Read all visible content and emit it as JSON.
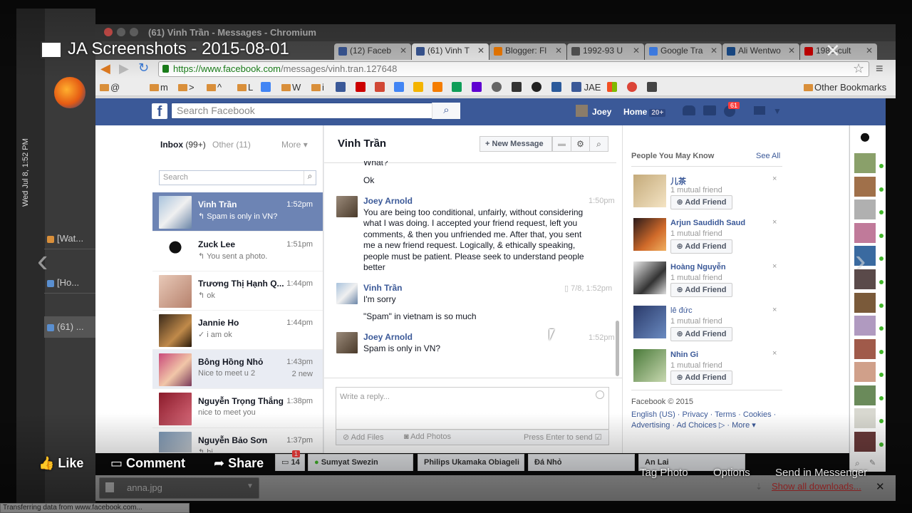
{
  "slideshow": {
    "title": "JA Screenshots - 2015-08-01",
    "like": "Like",
    "comment": "Comment",
    "share": "Share",
    "tag_photo": "Tag Photo",
    "options": "Options",
    "send_messenger": "Send in Messenger"
  },
  "desktop": {
    "clock": "Wed Jul 8, 1:52 PM",
    "tasks": [
      {
        "label": "[Wat..."
      },
      {
        "label": "[Ho..."
      },
      {
        "label": "(61) ..."
      }
    ]
  },
  "browser": {
    "window_title": "(61) Vinh Trần - Messages - Chromium",
    "tabs": [
      {
        "label": "(12) Faceb",
        "color": "#3b5998"
      },
      {
        "label": "(61) Vinh T",
        "color": "#3b5998"
      },
      {
        "label": "Blogger: Fl",
        "color": "#f57d00"
      },
      {
        "label": "1992-93 U",
        "color": "#555555"
      },
      {
        "label": "Google Tra",
        "color": "#4285f4"
      },
      {
        "label": "Ali Wentwo",
        "color": "#1a4d8c"
      },
      {
        "label": "1988-cult",
        "color": "#cc0000"
      }
    ],
    "url_host": "https://www.facebook.com",
    "url_path": "/messages/vinh.tran.127648",
    "bookmarks": [
      {
        "label": "@"
      },
      {
        "label": "m"
      },
      {
        "label": ">"
      },
      {
        "label": "^"
      },
      {
        "label": "L"
      },
      {
        "label": "W"
      },
      {
        "label": "i"
      },
      {
        "label": "JAE"
      }
    ],
    "other_bookmarks": "Other Bookmarks"
  },
  "fb_header": {
    "search_placeholder": "Search Facebook",
    "user": "Joey",
    "home": "Home",
    "home_count": "20+",
    "notif_count": "61"
  },
  "inbox": {
    "inbox_label": "Inbox",
    "inbox_count": "(99+)",
    "other_label": "Other",
    "other_count": "(11)",
    "more_label": "More",
    "search_placeholder": "Search",
    "conversations": [
      {
        "name": "Vinh Trần",
        "snippet": "↰ Spam is only in VN?",
        "time": "1:52pm",
        "new": ""
      },
      {
        "name": "Zuck Lee",
        "snippet": "↰ You sent a photo.",
        "time": "1:51pm",
        "new": ""
      },
      {
        "name": "Trương Thị Hạnh Q...",
        "snippet": "↰ ok",
        "time": "1:44pm",
        "new": ""
      },
      {
        "name": "Jannie Ho",
        "snippet": "✓ i am ok",
        "time": "1:44pm",
        "new": ""
      },
      {
        "name": "Bông Hồng Nhỏ",
        "snippet": "Nice to meet u 2",
        "time": "1:43pm",
        "new": "2 new"
      },
      {
        "name": "Nguyễn Trọng Thắng",
        "snippet": "nice to meet you",
        "time": "1:38pm",
        "new": ""
      },
      {
        "name": "Nguyễn Bảo Sơn",
        "snippet": "↰ hi",
        "time": "1:37pm",
        "new": ""
      }
    ]
  },
  "thread": {
    "title": "Vinh Trần",
    "new_message": "New Message",
    "cut_text": "What?",
    "ok_text": "Ok",
    "messages": [
      {
        "name": "Joey Arnold",
        "time": "1:50pm",
        "text": "You are being too conditional, unfairly, without considering what I was doing. I accepted your friend request, left you comments, & then you unfriended me. After that, you sent me a new friend request. Logically, & ethically speaking, people must be patient. Please seek to understand people better"
      },
      {
        "name": "Vinh Trần",
        "time": "7/8, 1:52pm",
        "text": "I'm sorry",
        "text2": "\"Spam\" in vietnam is so much"
      },
      {
        "name": "Joey Arnold",
        "time": "1:52pm",
        "text": "Spam is only in VN?"
      }
    ],
    "reply_placeholder": "Write a reply...",
    "add_files": "Add Files",
    "add_photos": "Add Photos",
    "press_enter": "Press Enter to send"
  },
  "pymk": {
    "title": "People You May Know",
    "see_all": "See All",
    "add_label": "Add Friend",
    "mutual": "1 mutual friend",
    "people": [
      {
        "name": "儿茶"
      },
      {
        "name": "Arjun Saudidh Saud"
      },
      {
        "name": "Hoàng Nguyễn"
      },
      {
        "name": "lê đức"
      },
      {
        "name": "Nhin Gi"
      }
    ]
  },
  "footer": {
    "copyright": "Facebook © 2015",
    "links1": "English (US) · Privacy · Terms · Cookies ·",
    "links2": "Advertising · Ad Choices ▷ · More ▾"
  },
  "chat_tabs": [
    {
      "label": "14",
      "badge": "1"
    },
    {
      "label": "Sumyat Swezin"
    },
    {
      "label": "Philips Ukamaka Obiageli"
    },
    {
      "label": "Đá Nhỏ"
    },
    {
      "label": "An Lai"
    }
  ],
  "downloads": {
    "file": "anna.jpg",
    "show_all": "Show all downloads..."
  },
  "status": "Transferring data from www.facebook.com...",
  "colors": {
    "fb_blue": "#3b5998",
    "selected_row": "#6d84b4",
    "online": "#42b72a"
  }
}
